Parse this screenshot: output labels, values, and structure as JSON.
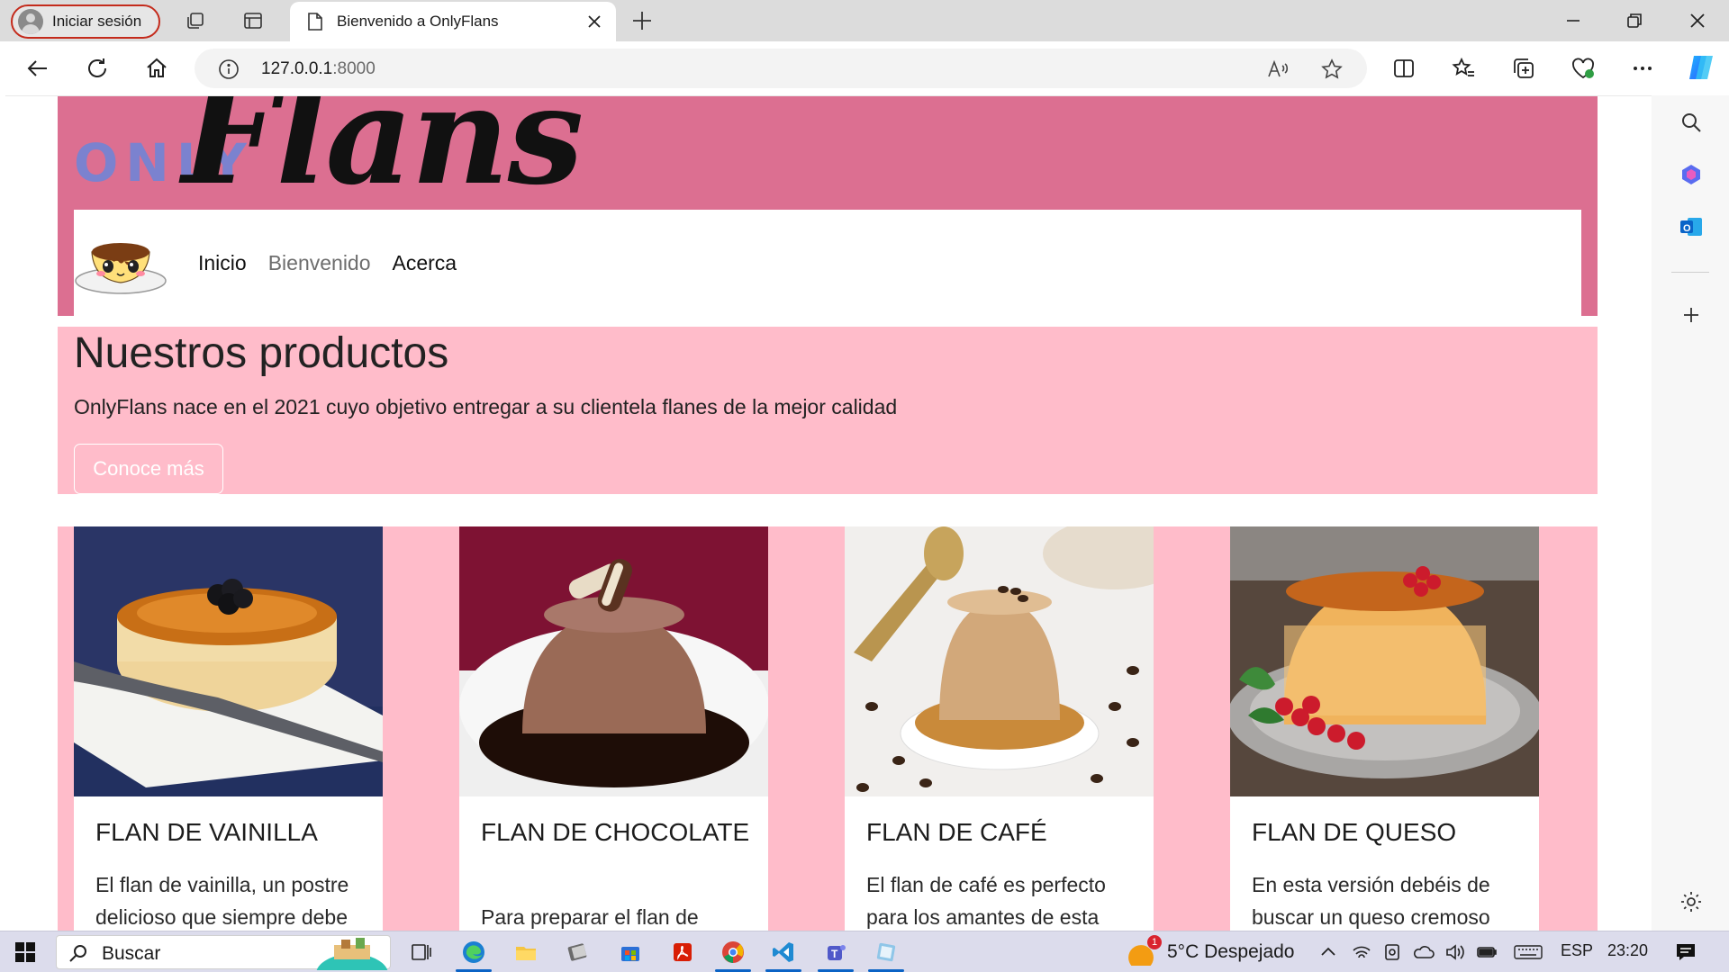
{
  "browser": {
    "profile_label": "Iniciar sesión",
    "tab_title": "Bienvenido a OnlyFlans",
    "url_host": "127.0.0.1",
    "url_port": ":8000"
  },
  "site": {
    "logo_only": "ONLY",
    "logo_flans": "Flans",
    "nav": [
      "Inicio",
      "Bienvenido",
      "Acerca"
    ],
    "hero": {
      "title": "Nuestros productos",
      "text": "OnlyFlans nace en el 2021 cuyo objetivo entregar a su clientela flanes de la mejor calidad",
      "button": "Conoce más"
    },
    "cards": [
      {
        "title": "FLAN DE VAINILLA",
        "text": "El flan de vainilla, un postre delicioso que siempre debe"
      },
      {
        "title": "FLAN DE CHOCOLATE",
        "text": "Para preparar el flan de"
      },
      {
        "title": "FLAN DE CAFÉ",
        "text": "El flan de café es perfecto para los amantes de esta"
      },
      {
        "title": "FLAN DE QUESO",
        "text": "En esta versión debéis de buscar un queso cremoso"
      }
    ]
  },
  "taskbar": {
    "search_label": "Buscar",
    "weather_badge": "1",
    "weather": "5°C  Despejado",
    "lang": "ESP",
    "time": "23:20"
  },
  "colors": {
    "header_pink": "#dc6f91",
    "band_pink": "#ffbcca",
    "logo_blue": "#7b82cf"
  }
}
